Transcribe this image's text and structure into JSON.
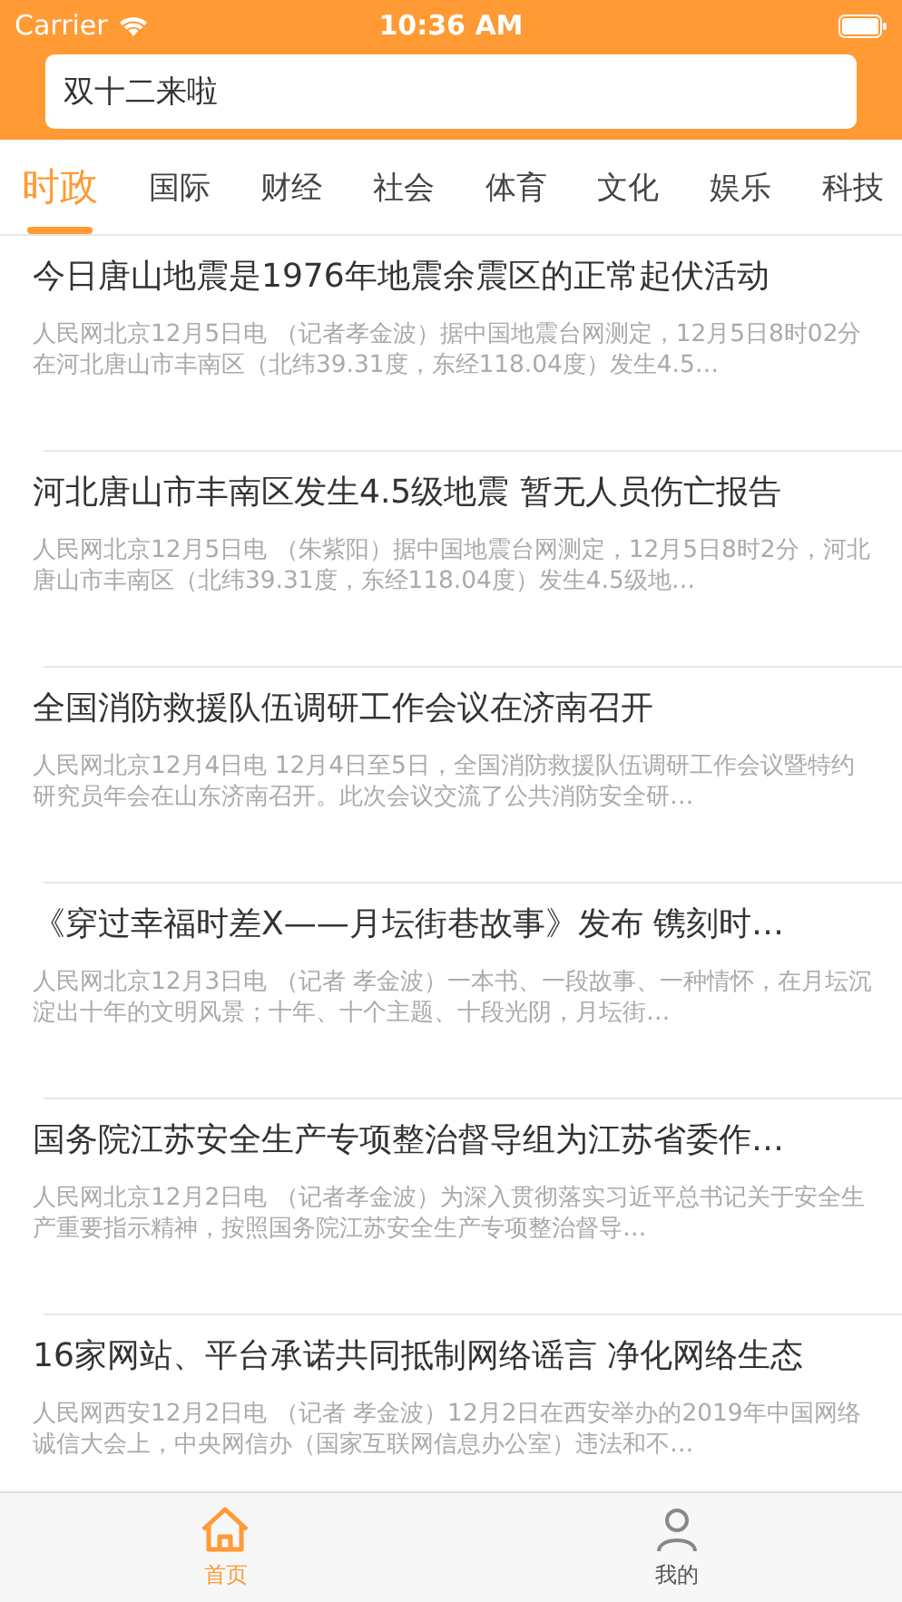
{
  "status_bar": {
    "carrier": "Carrier",
    "time": "10:36 AM"
  },
  "search": {
    "value": "双十二来啦"
  },
  "tabs": [
    {
      "label": "时政",
      "selected": true
    },
    {
      "label": "国际",
      "selected": false
    },
    {
      "label": "财经",
      "selected": false
    },
    {
      "label": "社会",
      "selected": false
    },
    {
      "label": "体育",
      "selected": false
    },
    {
      "label": "文化",
      "selected": false
    },
    {
      "label": "娱乐",
      "selected": false
    },
    {
      "label": "科技",
      "selected": false
    }
  ],
  "news": [
    {
      "title": "今日唐山地震是1976年地震余震区的正常起伏活动",
      "summary": "人民网北京12月5日电 （记者孝金波）据中国地震台网测定，12月5日8时02分在河北唐山市丰南区（北纬39.31度，东经118.04度）发生4.5…"
    },
    {
      "title": "河北唐山市丰南区发生4.5级地震 暂无人员伤亡报告",
      "summary": "人民网北京12月5日电 （朱紫阳）据中国地震台网测定，12月5日8时2分，河北唐山市丰南区（北纬39.31度，东经118.04度）发生4.5级地…"
    },
    {
      "title": "全国消防救援队伍调研工作会议在济南召开",
      "summary": "人民网北京12月4日电 12月4日至5日，全国消防救援队伍调研工作会议暨特约研究员年会在山东济南召开。此次会议交流了公共消防安全研…"
    },
    {
      "title": "《穿过幸福时差X——月坛街巷故事》发布 镌刻时…",
      "summary": "人民网北京12月3日电 （记者 孝金波）一本书、一段故事、一种情怀，在月坛沉淀出十年的文明风景；十年、十个主题、十段光阴，月坛街…"
    },
    {
      "title": "国务院江苏安全生产专项整治督导组为江苏省委作…",
      "summary": "人民网北京12月2日电 （记者孝金波）为深入贯彻落实习近平总书记关于安全生产重要指示精神，按照国务院江苏安全生产专项整治督导…"
    },
    {
      "title": "16家网站、平台承诺共同抵制网络谣言 净化网络生态",
      "summary": "人民网西安12月2日电 （记者 孝金波）12月2日在西安举办的2019年中国网络诚信大会上，中央网信办（国家互联网信息办公室）违法和不…"
    }
  ],
  "bottom_tabs": [
    {
      "label": "首页",
      "kind": "home",
      "selected": true
    },
    {
      "label": "我的",
      "kind": "profile",
      "selected": false
    }
  ]
}
